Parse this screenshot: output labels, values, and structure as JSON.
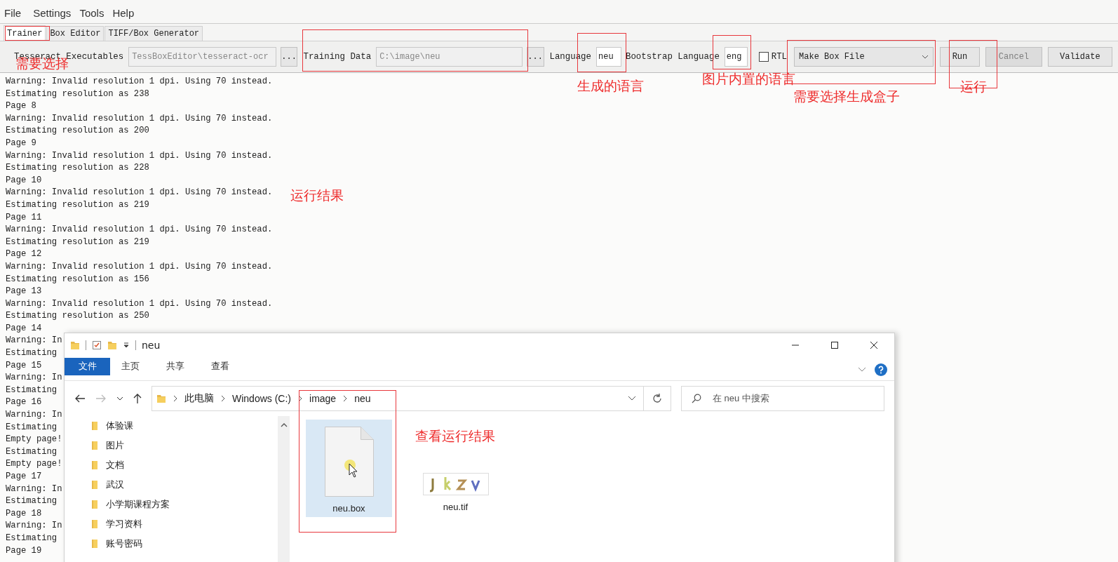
{
  "menu": [
    {
      "label": "File"
    },
    {
      "label": "Settings"
    },
    {
      "label": "Tools"
    },
    {
      "label": "Help"
    }
  ],
  "tabs": [
    {
      "label": "Trainer",
      "selected": true
    },
    {
      "label": "Box Editor",
      "selected": false
    },
    {
      "label": "TIFF/Box Generator",
      "selected": false
    }
  ],
  "toolbar": {
    "executables_label": "Tesseract Executables",
    "executables_path": {
      "value": "TessBoxEditor\\tesseract-ocr",
      "disabled": true
    },
    "training_label": "Training Data",
    "training_path": {
      "value": "C:\\image\\neu",
      "disabled": true
    },
    "browse_buttons": [
      "...",
      "..."
    ],
    "language_label": "Language",
    "language_value": "neu",
    "bootstrap_label": "Bootstrap Language",
    "bootstrap_value": "eng",
    "rtl": {
      "label": "RTL",
      "checked": false
    },
    "action": "Make Box File",
    "buttons": [
      {
        "label": "Run",
        "disabled": false
      },
      {
        "label": "Cancel",
        "disabled": true
      },
      {
        "label": "Validate",
        "disabled": false
      }
    ]
  },
  "log": [
    "Warning: Invalid resolution 1 dpi. Using 70 instead.",
    "Estimating resolution as 238",
    "Page 8",
    "Warning: Invalid resolution 1 dpi. Using 70 instead.",
    "Estimating resolution as 200",
    "Page 9",
    "Warning: Invalid resolution 1 dpi. Using 70 instead.",
    "Estimating resolution as 228",
    "Page 10",
    "Warning: Invalid resolution 1 dpi. Using 70 instead.",
    "Estimating resolution as 219",
    "Page 11",
    "Warning: Invalid resolution 1 dpi. Using 70 instead.",
    "Estimating resolution as 219",
    "Page 12",
    "Warning: Invalid resolution 1 dpi. Using 70 instead.",
    "Estimating resolution as 156",
    "Page 13",
    "Warning: Invalid resolution 1 dpi. Using 70 instead.",
    "Estimating resolution as 250",
    "Page 14",
    "Warning: In",
    "Estimating",
    "Page 15",
    "Warning: In",
    "Estimating",
    "Page 16",
    "Warning: In",
    "Estimating",
    "Empty page!",
    "Estimating",
    "Empty page!",
    "Page 17",
    "Warning: In",
    "Estimating",
    "Page 18",
    "Warning: In",
    "Estimating",
    "Page 19"
  ],
  "explorer": {
    "title": "neu",
    "ribbon_tabs": [
      {
        "label": "文件",
        "selected": true
      },
      {
        "label": "主页",
        "selected": false
      },
      {
        "label": "共享",
        "selected": false
      },
      {
        "label": "查看",
        "selected": false
      }
    ],
    "breadcrumb": [
      "此电脑",
      "Windows (C:)",
      "image",
      "neu"
    ],
    "search_placeholder": "在 neu 中搜索",
    "nav_items": [
      "体验课",
      "图片",
      "文档",
      "武汉",
      "小学期课程方案",
      "学习资料",
      "账号密码"
    ],
    "files": [
      {
        "name": "neu.box",
        "kind": "document",
        "selected": true
      },
      {
        "name": "neu.tif",
        "selected": false
      }
    ]
  },
  "annotations": [
    {
      "text": "需要选择"
    },
    {
      "text": "生成的语言"
    },
    {
      "text": "图片内置的语言"
    },
    {
      "text": "需要选择生成盒子"
    },
    {
      "text": "运行"
    },
    {
      "text": "运行结果"
    },
    {
      "text": "查看运行结果"
    }
  ]
}
